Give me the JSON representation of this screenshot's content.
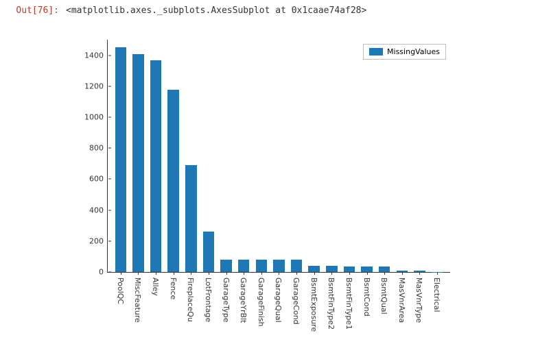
{
  "prompt": "Out[76]:",
  "repr": "<matplotlib.axes._subplots.AxesSubplot at 0x1caae74af28>",
  "chart_data": {
    "type": "bar",
    "series_name": "MissingValues",
    "categories": [
      "PoolQC",
      "MiscFeature",
      "Alley",
      "Fence",
      "FireplaceQu",
      "LotFrontage",
      "GarageType",
      "GarageYrBlt",
      "GarageFinish",
      "GarageQual",
      "GarageCond",
      "BsmtExposure",
      "BsmtFinType2",
      "BsmtFinType1",
      "BsmtCond",
      "BsmtQual",
      "MasVnrArea",
      "MasVnrType",
      "Electrical"
    ],
    "values": [
      1453,
      1406,
      1369,
      1179,
      690,
      259,
      81,
      81,
      81,
      81,
      81,
      38,
      38,
      37,
      37,
      37,
      8,
      8,
      1
    ],
    "ylim": [
      0,
      1500
    ],
    "yticks": [
      0,
      200,
      400,
      600,
      800,
      1000,
      1200,
      1400
    ],
    "title": "",
    "xlabel": "",
    "ylabel": "",
    "legend_position": "upper right",
    "bar_color": "#1f77b4"
  }
}
